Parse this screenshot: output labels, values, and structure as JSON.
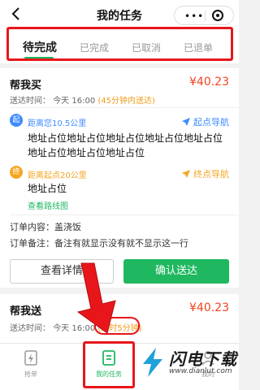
{
  "nav": {
    "title": "我的任务",
    "capsule_dots": "•••"
  },
  "tabs": [
    {
      "label": "待完成",
      "active": true
    },
    {
      "label": "已完成",
      "active": false
    },
    {
      "label": "已取消",
      "active": false
    },
    {
      "label": "已退单",
      "active": false
    }
  ],
  "order1": {
    "title": "帮我买",
    "price": "¥40.23",
    "time_label": "送达时间：",
    "time_value": "今天 16:00",
    "time_remain": "(45分钟内送达)",
    "start": {
      "badge": "起",
      "distance": "距离您10.5公里",
      "nav_label": "起点导航",
      "address": "地址占位地址占位地址占位地址占位地址占位地址占位地址占位地址占位"
    },
    "end": {
      "badge": "终",
      "distance": "距离起点20公里",
      "nav_label": "终点导航",
      "address": "地址占位"
    },
    "route_link": "查看路线图",
    "content_label": "订单内容：",
    "content_value": "盖浇饭",
    "note_label": "订单备注：",
    "note_value": "备注有就显示没有就不显示这一行",
    "btn_view": "查看详情",
    "btn_confirm": "确认送达"
  },
  "order2": {
    "title": "帮我送",
    "price": "¥40.23",
    "time_label": "送达时间：",
    "time_value": "今天 16:00",
    "time_remain": "(超时5分钟)"
  },
  "tabbar": [
    {
      "label": "抢单",
      "icon": "lightning-icon",
      "active": false
    },
    {
      "label": "我的任务",
      "icon": "task-list-icon",
      "active": true
    },
    {
      "label": "我的",
      "icon": "person-icon",
      "active": false
    }
  ],
  "watermark": {
    "text": "闪电下载",
    "url": "www.dianlut.com"
  },
  "colors": {
    "accent_green": "#1fb860",
    "price_red": "#f2441f",
    "annotation_red": "#e8161b",
    "start_blue": "#3d8bff",
    "end_orange": "#f5a623"
  }
}
